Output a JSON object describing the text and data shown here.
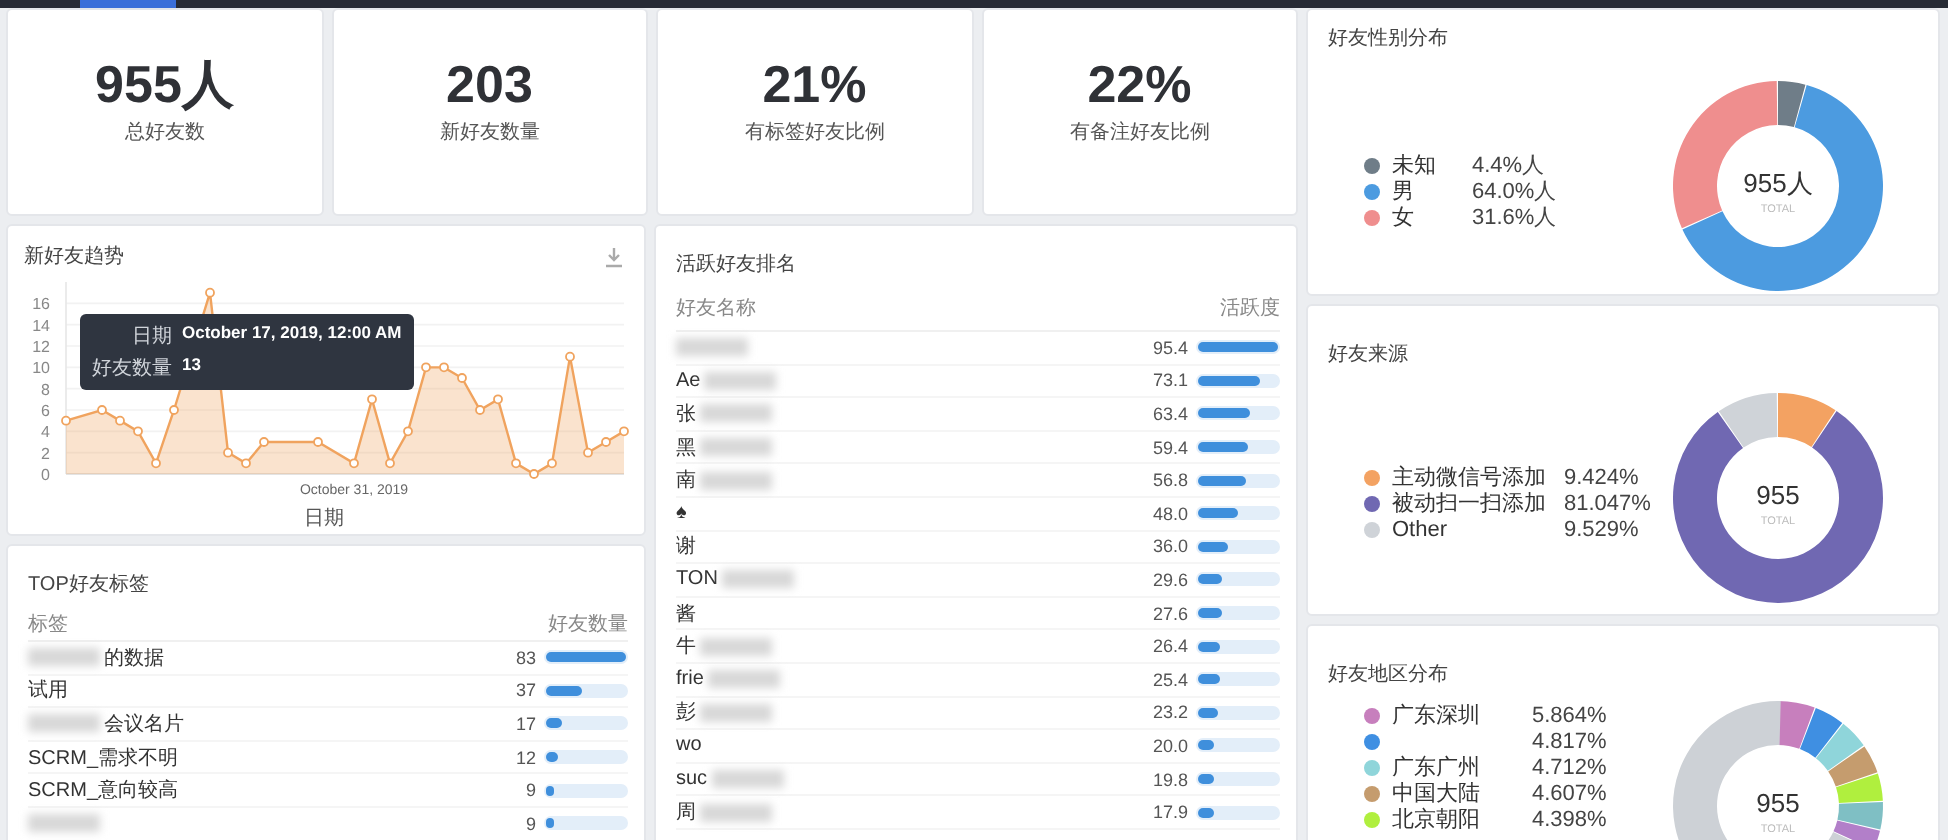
{
  "stats": [
    {
      "value": "955人",
      "label": "总好友数"
    },
    {
      "value": "203",
      "label": "新好友数量"
    },
    {
      "value": "21%",
      "label": "有标签好友比例"
    },
    {
      "value": "22%",
      "label": "有备注好友比例"
    }
  ],
  "trend": {
    "chart_data": {
      "type": "area",
      "title": "新好友趋势",
      "xlabel": "日期",
      "grid": true,
      "series": [
        {
          "color": "#f0a35e",
          "values": [
            5,
            null,
            6,
            5,
            4,
            1,
            6,
            null,
            17,
            2,
            1,
            3,
            null,
            null,
            3,
            null,
            1,
            7,
            1,
            4,
            10,
            10,
            9,
            6,
            7,
            1,
            0,
            1,
            11,
            2,
            3,
            4
          ]
        }
      ],
      "yticks": [
        0,
        2,
        4,
        6,
        8,
        10,
        12,
        14,
        16
      ],
      "ylim": [
        0,
        18
      ]
    },
    "x_tick_label": "October 31, 2019",
    "tooltip": {
      "rows": [
        {
          "label": "日期",
          "value": "October 17, 2019, 12:00 AM"
        },
        {
          "label": "好友数量",
          "value": "13"
        }
      ]
    }
  },
  "tags": {
    "title": "TOP好友标签",
    "columns": [
      "标签",
      "好友数量"
    ],
    "rows": [
      {
        "name": "的数据",
        "blurred": true,
        "count": "83",
        "level": 1.0
      },
      {
        "name": "试用",
        "blurred": false,
        "count": "37",
        "level": 0.45
      },
      {
        "name": "会议名片",
        "blurred": true,
        "count": "17",
        "level": 0.2
      },
      {
        "name": "SCRM_需求不明",
        "blurred": false,
        "count": "12",
        "level": 0.14
      },
      {
        "name": "SCRM_意向较高",
        "blurred": false,
        "count": "9",
        "level": 0.11
      },
      {
        "blurred": true,
        "count": "9",
        "level": 0.11
      }
    ]
  },
  "ranking": {
    "title": "活跃好友排名",
    "columns": [
      "好友名称",
      "活跃度"
    ],
    "rows": [
      {
        "blurred": true,
        "score": "95.4",
        "level": 1.0
      },
      {
        "name": "Ae",
        "blurred": true,
        "score": "73.1",
        "level": 0.77
      },
      {
        "name": "张",
        "blurred": true,
        "score": "63.4",
        "level": 0.66
      },
      {
        "name": "黑",
        "blurred": true,
        "score": "59.4",
        "level": 0.62
      },
      {
        "name": "南",
        "blurred": true,
        "score": "56.8",
        "level": 0.6
      },
      {
        "name": "♠",
        "blurred": false,
        "score": "48.0",
        "level": 0.5
      },
      {
        "name": "谢",
        "blurred": false,
        "score": "36.0",
        "level": 0.38
      },
      {
        "name": "TON",
        "blurred": true,
        "score": "29.6",
        "level": 0.31
      },
      {
        "name": "酱",
        "blurred": false,
        "score": "27.6",
        "level": 0.29
      },
      {
        "name": "牛",
        "blurred": true,
        "score": "26.4",
        "level": 0.28
      },
      {
        "name": "frie",
        "blurred": true,
        "score": "25.4",
        "level": 0.27
      },
      {
        "name": "彭",
        "blurred": true,
        "score": "23.2",
        "level": 0.24
      },
      {
        "name": "wo",
        "blurred": false,
        "score": "20.0",
        "level": 0.21
      },
      {
        "name": "suc",
        "blurred": true,
        "score": "19.8",
        "level": 0.21
      },
      {
        "name": "周",
        "blurred": true,
        "score": "17.9",
        "level": 0.19
      }
    ]
  },
  "donuts": [
    {
      "title": "好友性别分布",
      "total": "955人",
      "caption": "TOTAL",
      "items": [
        {
          "label": "未知",
          "value": "4.4%人",
          "color": "#6f7d88"
        },
        {
          "label": "男",
          "value": "64.0%人",
          "color": "#4c9be0"
        },
        {
          "label": "女",
          "value": "31.6%人",
          "color": "#ef8e8e"
        }
      ],
      "chart_data": {
        "type": "donut",
        "values": [
          4.4,
          64.0,
          31.6
        ]
      }
    },
    {
      "title": "好友来源",
      "total": "955",
      "caption": "TOTAL",
      "items": [
        {
          "label": "主动微信号添加",
          "value": "9.424%",
          "color": "#f3a262"
        },
        {
          "label": "被动扫一扫添加",
          "value": "81.047%",
          "color": "#7068b2"
        },
        {
          "label": "Other",
          "value": "9.529%",
          "color": "#cfd3d8"
        }
      ],
      "chart_data": {
        "type": "donut",
        "values": [
          9.424,
          81.047,
          9.529
        ]
      }
    },
    {
      "title": "好友地区分布",
      "total": "955",
      "caption": "TOTAL",
      "items": [
        {
          "label": "广东深圳",
          "value": "5.864%",
          "color": "#c77fbd"
        },
        {
          "value": "4.817%",
          "color": "#3f8fe2"
        },
        {
          "label": "广东广州",
          "value": "4.712%",
          "color": "#8fd5da"
        },
        {
          "label": "中国大陆",
          "value": "4.607%",
          "color": "#c59c6e"
        },
        {
          "label": "北京朝阳",
          "value": "4.398%",
          "color": "#b0ef3e"
        }
      ],
      "chart_data": {
        "type": "donut",
        "values": [
          5.864,
          4.817,
          4.712,
          4.607,
          4.398,
          4.398,
          3.2,
          68.604
        ]
      }
    }
  ]
}
